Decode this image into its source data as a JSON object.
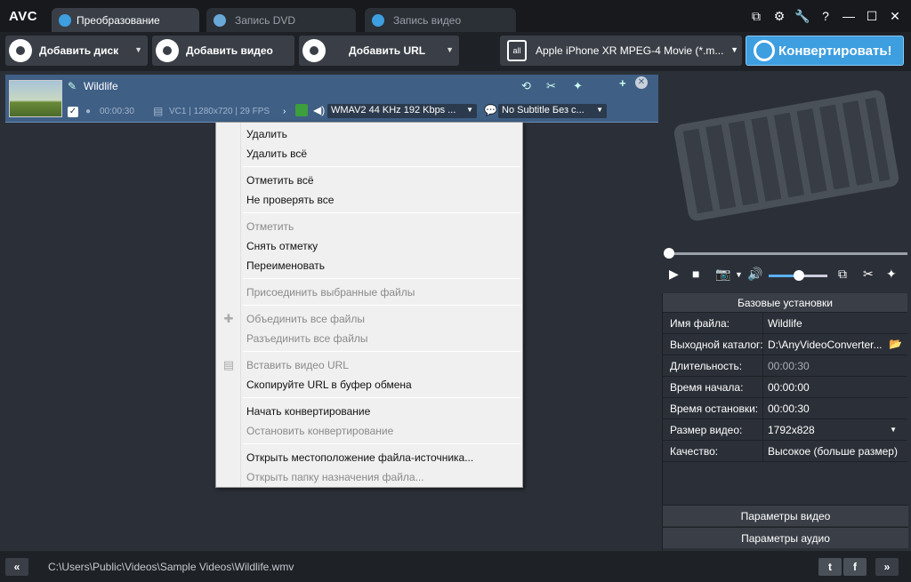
{
  "app": {
    "logo": "AVC"
  },
  "tabs": [
    {
      "label": "Преобразование"
    },
    {
      "label": "Запись DVD"
    },
    {
      "label": "Запись видео"
    }
  ],
  "window_controls": [
    "⧉",
    "⚙",
    "🔧",
    "?",
    "—",
    "☐",
    "✕"
  ],
  "toolbar": {
    "add_disc": "Добавить диск",
    "add_video": "Добавить видео",
    "add_url": "Добавить URL",
    "profile": "Apple iPhone XR MPEG-4 Movie (*.m...",
    "convert": "Конвертировать!"
  },
  "file": {
    "name": "Wildlife",
    "duration": "00:00:30",
    "video_info": "VC1 | 1280x720 | 29 FPS",
    "audio": "WMAV2 44 KHz 192 Kbps ...",
    "subtitle": "No Subtitle Без с..."
  },
  "context_menu": [
    {
      "label": "Удалить",
      "enabled": true
    },
    {
      "label": "Удалить всё",
      "enabled": true
    },
    {
      "label": "Отметить всё",
      "enabled": true
    },
    {
      "label": "Не проверять все",
      "enabled": true
    },
    {
      "label": "Отметить",
      "enabled": false
    },
    {
      "label": "Снять отметку",
      "enabled": true
    },
    {
      "label": "Переименовать",
      "enabled": true
    },
    {
      "label": "Присоединить выбранные файлы",
      "enabled": false
    },
    {
      "label": "Объединить все файлы",
      "enabled": false
    },
    {
      "label": "Разъединить все файлы",
      "enabled": false
    },
    {
      "label": "Вставить видео URL",
      "enabled": false
    },
    {
      "label": "Скопируйте URL в буфер обмена",
      "enabled": true
    },
    {
      "label": "Начать конвертирование",
      "enabled": true
    },
    {
      "label": "Остановить конвертирование",
      "enabled": false
    },
    {
      "label": "Открыть местоположение файла-источника...",
      "enabled": true
    },
    {
      "label": "Открыть папку назначения файла...",
      "enabled": false
    }
  ],
  "settings": {
    "header": "Базовые установки",
    "rows": [
      {
        "key": "Имя файла:",
        "value": "Wildlife"
      },
      {
        "key": "Выходной каталог:",
        "value": "D:\\AnyVideoConverter..."
      },
      {
        "key": "Длительность:",
        "value": "00:00:30"
      },
      {
        "key": "Время начала:",
        "value": "00:00:00"
      },
      {
        "key": "Время остановки:",
        "value": "00:00:30"
      },
      {
        "key": "Размер видео:",
        "value": "1792x828"
      },
      {
        "key": "Качество:",
        "value": "Высокое (больше размер)"
      }
    ],
    "video_params": "Параметры видео",
    "audio_params": "Параметры аудио"
  },
  "status": {
    "path": "C:\\Users\\Public\\Videos\\Sample Videos\\Wildlife.wmv"
  },
  "colors": {
    "accent": "#3d9ee0",
    "selected_row": "#3f5f85"
  }
}
